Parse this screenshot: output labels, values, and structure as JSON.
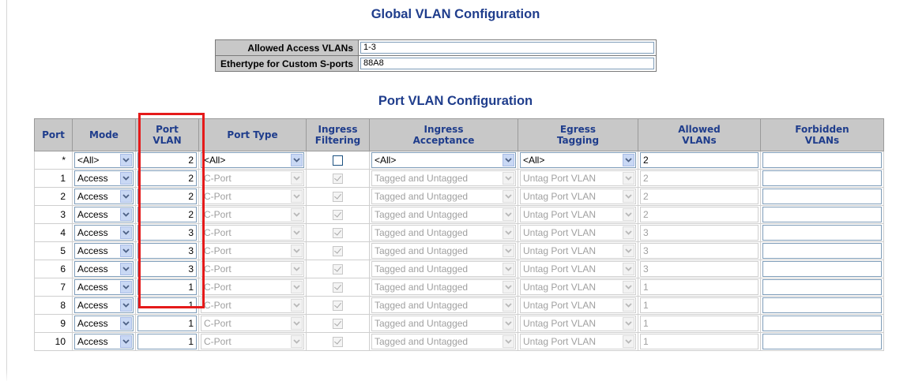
{
  "global": {
    "title": "Global VLAN Configuration",
    "allowed_access_vlans_label": "Allowed Access VLANs",
    "allowed_access_vlans_value": "1-3",
    "ethertype_label": "Ethertype for Custom S-ports",
    "ethertype_value": "88A8"
  },
  "port_config": {
    "title": "Port VLAN Configuration",
    "columns": [
      "Port",
      "Mode",
      "Port VLAN",
      "Port Type",
      "Ingress Filtering",
      "Ingress Acceptance",
      "Egress Tagging",
      "Allowed VLANs",
      "Forbidden VLANs"
    ],
    "column_lines": [
      [
        "Port"
      ],
      [
        "Mode"
      ],
      [
        "Port",
        "VLAN"
      ],
      [
        "Port Type"
      ],
      [
        "Ingress",
        "Filtering"
      ],
      [
        "Ingress",
        "Acceptance"
      ],
      [
        "Egress",
        "Tagging"
      ],
      [
        "Allowed",
        "VLANs"
      ],
      [
        "Forbidden",
        "VLANs"
      ]
    ],
    "rows": [
      {
        "port": "*",
        "mode": "<All>",
        "port_vlan": "2",
        "port_type": "<All>",
        "ingress_filtering": false,
        "ingress_acceptance": "<All>",
        "egress_tagging": "<All>",
        "allowed_vlans": "2",
        "forbidden_vlans": "",
        "disabled": false
      },
      {
        "port": "1",
        "mode": "Access",
        "port_vlan": "2",
        "port_type": "C-Port",
        "ingress_filtering": true,
        "ingress_acceptance": "Tagged and Untagged",
        "egress_tagging": "Untag Port VLAN",
        "allowed_vlans": "2",
        "forbidden_vlans": "",
        "disabled": true
      },
      {
        "port": "2",
        "mode": "Access",
        "port_vlan": "2",
        "port_type": "C-Port",
        "ingress_filtering": true,
        "ingress_acceptance": "Tagged and Untagged",
        "egress_tagging": "Untag Port VLAN",
        "allowed_vlans": "2",
        "forbidden_vlans": "",
        "disabled": true
      },
      {
        "port": "3",
        "mode": "Access",
        "port_vlan": "2",
        "port_type": "C-Port",
        "ingress_filtering": true,
        "ingress_acceptance": "Tagged and Untagged",
        "egress_tagging": "Untag Port VLAN",
        "allowed_vlans": "2",
        "forbidden_vlans": "",
        "disabled": true
      },
      {
        "port": "4",
        "mode": "Access",
        "port_vlan": "3",
        "port_type": "C-Port",
        "ingress_filtering": true,
        "ingress_acceptance": "Tagged and Untagged",
        "egress_tagging": "Untag Port VLAN",
        "allowed_vlans": "3",
        "forbidden_vlans": "",
        "disabled": true
      },
      {
        "port": "5",
        "mode": "Access",
        "port_vlan": "3",
        "port_type": "C-Port",
        "ingress_filtering": true,
        "ingress_acceptance": "Tagged and Untagged",
        "egress_tagging": "Untag Port VLAN",
        "allowed_vlans": "3",
        "forbidden_vlans": "",
        "disabled": true
      },
      {
        "port": "6",
        "mode": "Access",
        "port_vlan": "3",
        "port_type": "C-Port",
        "ingress_filtering": true,
        "ingress_acceptance": "Tagged and Untagged",
        "egress_tagging": "Untag Port VLAN",
        "allowed_vlans": "3",
        "forbidden_vlans": "",
        "disabled": true
      },
      {
        "port": "7",
        "mode": "Access",
        "port_vlan": "1",
        "port_type": "C-Port",
        "ingress_filtering": true,
        "ingress_acceptance": "Tagged and Untagged",
        "egress_tagging": "Untag Port VLAN",
        "allowed_vlans": "1",
        "forbidden_vlans": "",
        "disabled": true
      },
      {
        "port": "8",
        "mode": "Access",
        "port_vlan": "1",
        "port_type": "C-Port",
        "ingress_filtering": true,
        "ingress_acceptance": "Tagged and Untagged",
        "egress_tagging": "Untag Port VLAN",
        "allowed_vlans": "1",
        "forbidden_vlans": "",
        "disabled": true
      },
      {
        "port": "9",
        "mode": "Access",
        "port_vlan": "1",
        "port_type": "C-Port",
        "ingress_filtering": true,
        "ingress_acceptance": "Tagged and Untagged",
        "egress_tagging": "Untag Port VLAN",
        "allowed_vlans": "1",
        "forbidden_vlans": "",
        "disabled": true
      },
      {
        "port": "10",
        "mode": "Access",
        "port_vlan": "1",
        "port_type": "C-Port",
        "ingress_filtering": true,
        "ingress_acceptance": "Tagged and Untagged",
        "egress_tagging": "Untag Port VLAN",
        "allowed_vlans": "1",
        "forbidden_vlans": "",
        "disabled": true
      }
    ]
  },
  "colors": {
    "title_blue": "#1f3d8c",
    "header_gray": "#c8c8c8",
    "highlight_red": "#e51a1a"
  },
  "icons": {
    "dropdown_arrow": "chevron-down-icon",
    "checkbox": "checkbox-icon"
  }
}
